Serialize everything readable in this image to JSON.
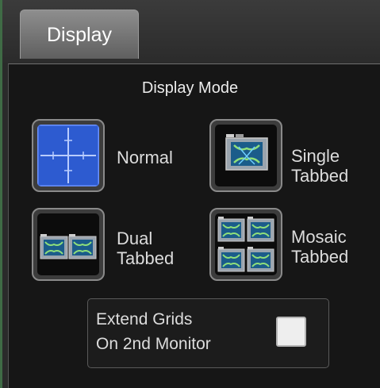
{
  "tabs": [
    {
      "label": "Display"
    }
  ],
  "display_mode": {
    "title": "Display Mode",
    "modes": [
      {
        "label_line1": "Normal",
        "label_line2": ""
      },
      {
        "label_line1": "Single",
        "label_line2": "Tabbed"
      },
      {
        "label_line1": "Dual",
        "label_line2": "Tabbed"
      },
      {
        "label_line1": "Mosaic",
        "label_line2": "Tabbed"
      }
    ]
  },
  "extend_grids": {
    "label_line1": "Extend Grids",
    "label_line2": "On 2nd Monitor",
    "checked": false
  },
  "colors": {
    "grid_blue": "#2d5bd0",
    "tab_gray": "#7c7c7c",
    "panel_black": "#161616"
  }
}
